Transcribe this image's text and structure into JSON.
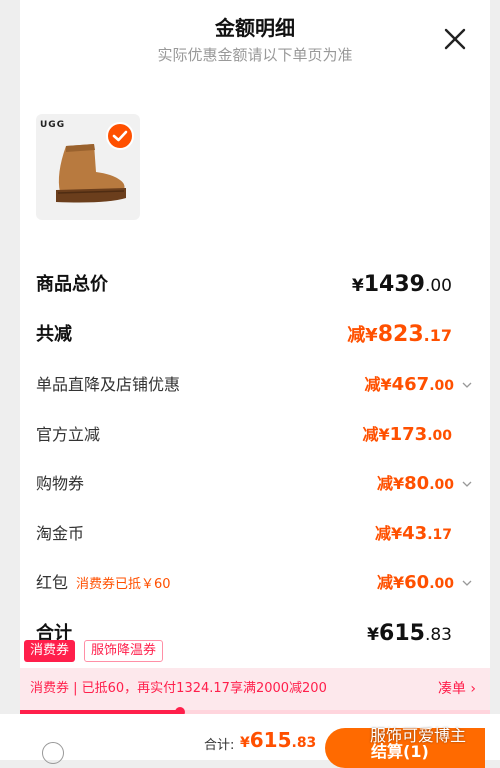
{
  "header": {
    "title": "金额明细",
    "subtitle": "实际优惠金额请以下单页为准"
  },
  "product": {
    "brand": "UGG",
    "selected": true
  },
  "summary": {
    "total_price": {
      "label": "商品总价",
      "currency": "¥",
      "main": "1439",
      "dec": ".00"
    },
    "total_discount": {
      "label": "共减",
      "prefix": "减¥",
      "main": "823",
      "dec": ".17"
    }
  },
  "discounts": [
    {
      "label": "单品直降及店铺优惠",
      "prefix": "减¥",
      "main": "467",
      "dec": ".00",
      "expandable": true
    },
    {
      "label": "官方立减",
      "prefix": "减¥",
      "main": "173",
      "dec": ".00",
      "expandable": false
    },
    {
      "label": "购物券",
      "prefix": "减¥",
      "main": "80",
      "dec": ".00",
      "expandable": true
    },
    {
      "label": "淘金币",
      "prefix": "减¥",
      "main": "43",
      "dec": ".17",
      "expandable": false
    },
    {
      "label": "红包",
      "note": "消费券已抵￥60",
      "prefix": "减¥",
      "main": "60",
      "dec": ".00",
      "expandable": true
    }
  ],
  "subtotal": {
    "label": "合计",
    "currency": "¥",
    "main": "615",
    "dec": ".83"
  },
  "tags": [
    "消费券",
    "服饰降温券"
  ],
  "promo": {
    "text": "消费券 | 已抵60，再实付1324.17享满2000减200",
    "link": "凑单 ›",
    "progress": 0.34
  },
  "bottom_bar": {
    "total_label": "合计:",
    "total_currency": "¥",
    "total_main": "615",
    "total_dec": ".83",
    "checkout_label": "结算(1)"
  },
  "watermark": "服饰可爱博主",
  "colors": {
    "accent": "#ff5000",
    "promo_red": "#ff1f4b",
    "checkout": "#ff6a00"
  }
}
